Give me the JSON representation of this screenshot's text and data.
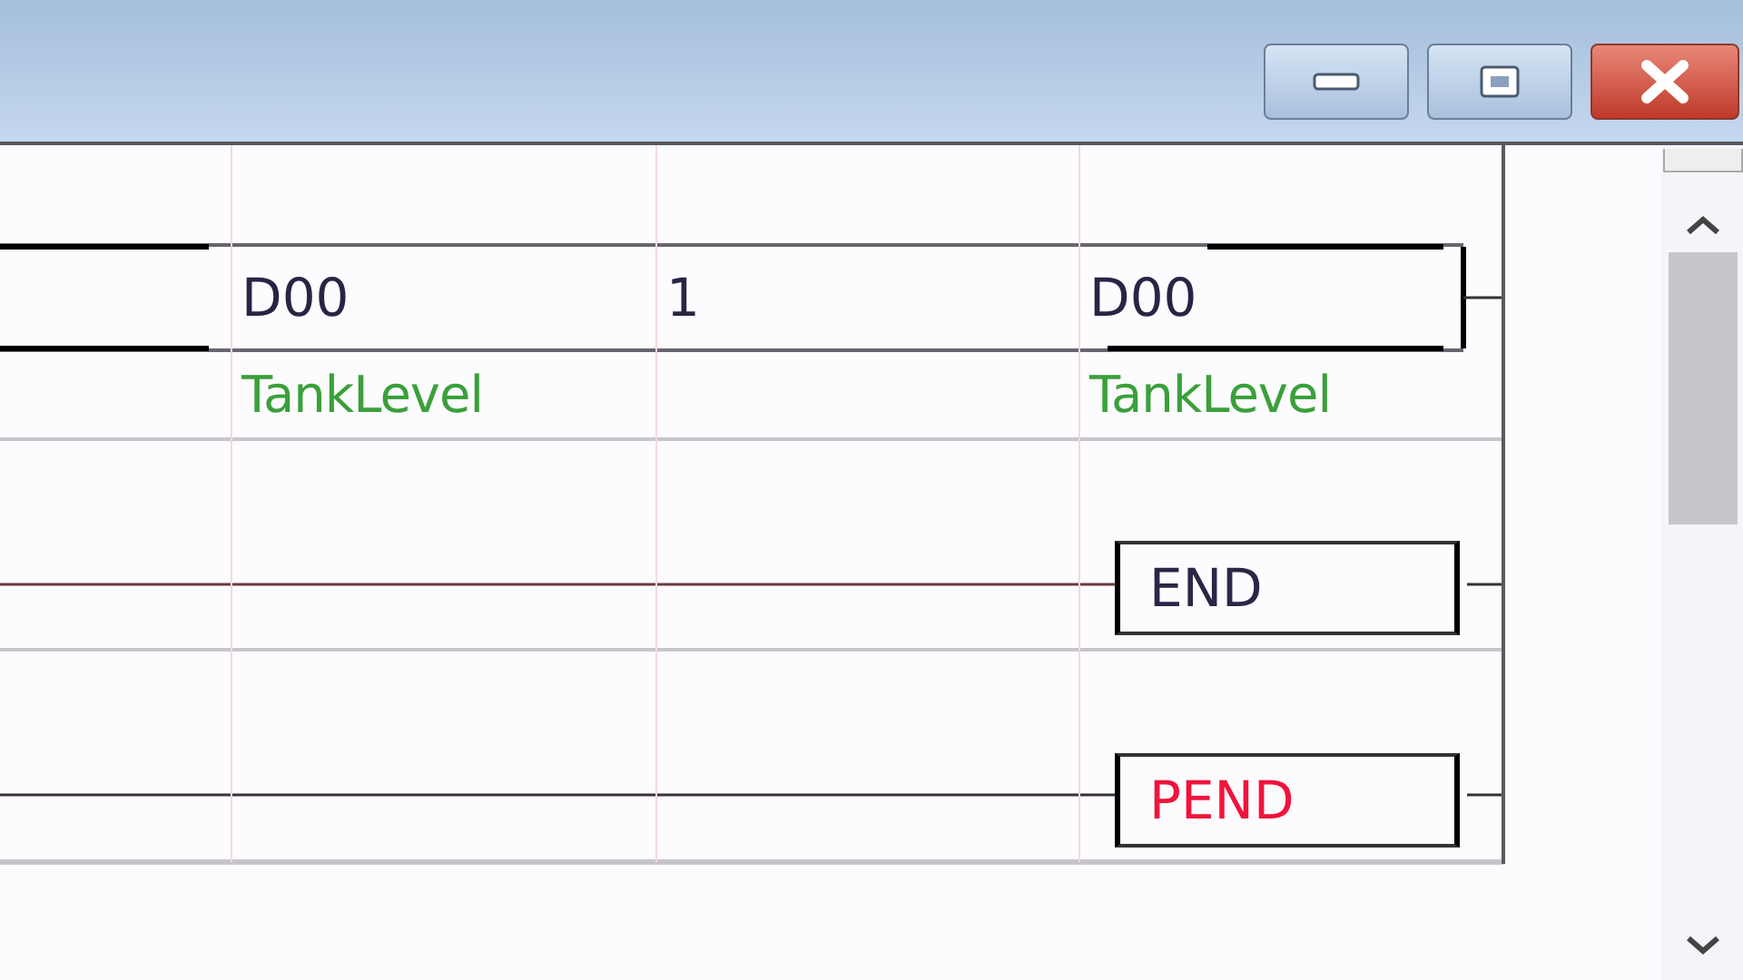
{
  "window": {
    "buttons": [
      {
        "kind": "minimize"
      },
      {
        "kind": "maximize"
      },
      {
        "kind": "close"
      }
    ]
  },
  "ladder": {
    "operand_row": [
      {
        "text": "D00",
        "comment": "TankLevel"
      },
      {
        "text": "1"
      },
      {
        "text": "D00",
        "comment": "TankLevel"
      }
    ],
    "outputs": [
      {
        "instruction": "END",
        "color": "#2a2646"
      },
      {
        "instruction": "PEND",
        "color": "#f0143c"
      }
    ]
  }
}
